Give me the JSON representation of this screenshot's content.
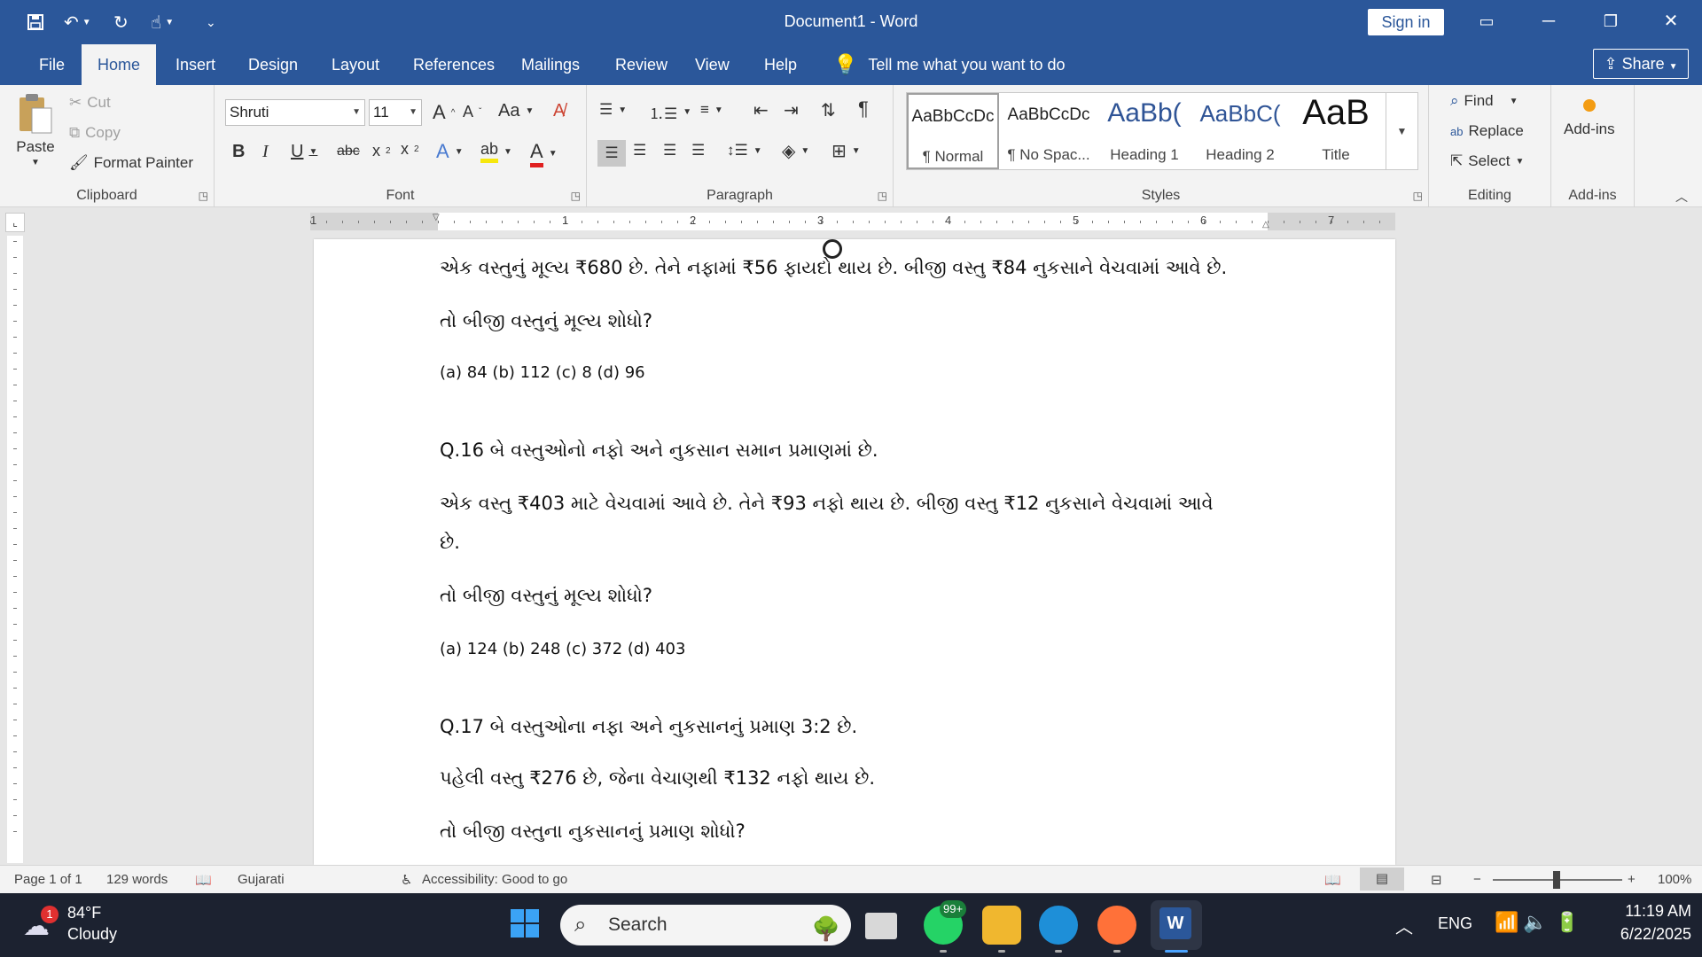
{
  "window": {
    "title": "Document1  -  Word",
    "sign_in": "Sign in"
  },
  "tabs": [
    "File",
    "Home",
    "Insert",
    "Design",
    "Layout",
    "References",
    "Mailings",
    "Review",
    "View",
    "Help"
  ],
  "tell_me": "Tell me what you want to do",
  "share": "Share",
  "ribbon": {
    "clipboard": {
      "label": "Clipboard",
      "paste": "Paste",
      "cut": "Cut",
      "copy": "Copy",
      "format_painter": "Format Painter"
    },
    "font": {
      "label": "Font",
      "font_name": "Shruti",
      "font_size": "11"
    },
    "paragraph": {
      "label": "Paragraph"
    },
    "styles": {
      "label": "Styles",
      "items": [
        {
          "preview": "AaBbCcDc",
          "name": "¶ Normal"
        },
        {
          "preview": "AaBbCcDc",
          "name": "¶ No Spac..."
        },
        {
          "preview": "AaBb(",
          "name": "Heading 1"
        },
        {
          "preview": "AaBbC(",
          "name": "Heading 2"
        },
        {
          "preview": "AaB",
          "name": "Title"
        }
      ]
    },
    "editing": {
      "label": "Editing",
      "find": "Find",
      "replace": "Replace",
      "select": "Select"
    },
    "addins": {
      "label": "Add-ins",
      "button": "Add-ins"
    }
  },
  "ruler": {
    "numbers": [
      "1",
      "1",
      "2",
      "3",
      "4",
      "5",
      "6",
      "7"
    ]
  },
  "document": {
    "lines": [
      "એક વસ્તુનું મૂલ્ય ₹680 છે. તેને નફામાં ₹56 ફાયદો થાય છે. બીજી વસ્તુ ₹84 નુકસાને વેચવામાં આવે છે.",
      "તો બીજી વસ્તુનું મૂલ્ય શોધો?",
      "(a) 84    (b) 112    (c) 8    (d) 96",
      "Q.16 બે વસ્તુઓનો નફો અને નુકસાન સમાન પ્રમાણમાં છે.",
      "એક વસ્તુ ₹403 માટે વેચવામાં આવે છે. તેને ₹93 નફો થાય છે. બીજી વસ્તુ ₹12 નુકસાને વેચવામાં આવે",
      "છે.",
      "તો બીજી વસ્તુનું મૂલ્ય શોધો?",
      "(a) 124    (b) 248    (c) 372    (d) 403",
      "Q.17 બે વસ્તુઓના નફા અને નુકસાનનું પ્રમાણ 3:2 છે.",
      "પહેલી વસ્તુ ₹276 છે, જેના વેચાણથી ₹132 નફો થાય છે.",
      "તો બીજી વસ્તુના નુકસાનનું પ્રમાણ શોધો?"
    ]
  },
  "status": {
    "page": "Page 1 of 1",
    "words": "129 words",
    "language": "Gujarati",
    "accessibility": "Accessibility: Good to go",
    "zoom": "100%"
  },
  "taskbar": {
    "weather_badge": "1",
    "temperature": "84°F",
    "condition": "Cloudy",
    "search": "Search",
    "whatsapp_badge": "99+",
    "language": "ENG",
    "time": "11:19 AM",
    "date": "6/22/2025"
  }
}
